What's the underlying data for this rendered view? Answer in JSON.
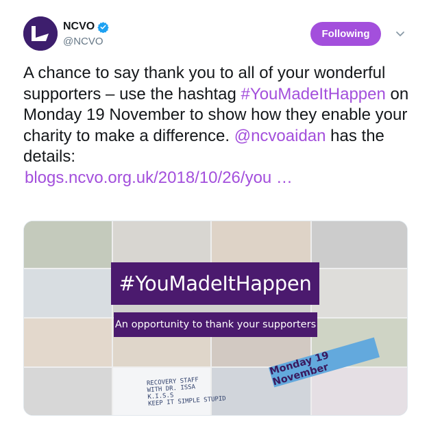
{
  "author": {
    "name": "NCVO",
    "handle": "@NCVO",
    "verified_icon": "verified-badge-icon"
  },
  "actions": {
    "follow_label": "Following",
    "menu_icon": "chevron-down-icon"
  },
  "tweet": {
    "text_1": "A chance to say thank you to all of your wonderful supporters – use the hashtag ",
    "hashtag": "#YouMadeItHappen",
    "text_2": " on Monday 19 November to show how they enable your charity to make a difference. ",
    "mention": "@ncvoaidan",
    "text_3": " has the details:",
    "link": "blogs.ncvo.org.uk/2018/10/26/you …"
  },
  "media": {
    "headline": "#YouMadeItHappen",
    "subheadline": "An opportunity to thank your supporters",
    "date_tag": "Monday 19 November",
    "whiteboard_text": "RECOVERY STAFF\nWITH DR. ISSA\nK.I.S.S\nKEEP IT SIMPLE STUPID"
  },
  "colors": {
    "accent": "#a34fdc",
    "banner": "#4b1a6e",
    "date_tag": "#63a9dd"
  }
}
